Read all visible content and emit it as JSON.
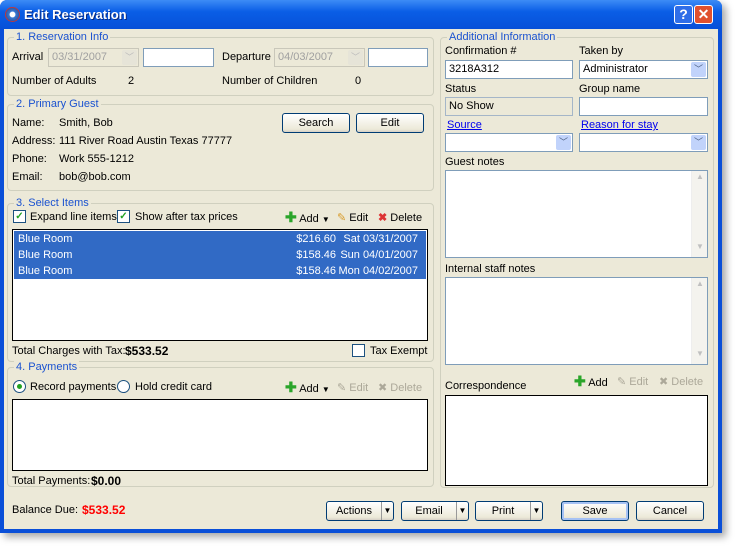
{
  "window": {
    "title": "Edit Reservation",
    "help": "?",
    "close": "✕"
  },
  "reservation": {
    "legend": "1. Reservation Info",
    "arrival_label": "Arrival",
    "arrival_date": "03/31/2007",
    "arrival_time": "",
    "departure_label": "Departure",
    "departure_date": "04/03/2007",
    "departure_time": "",
    "adults_label": "Number of Adults",
    "adults": "2",
    "children_label": "Number of Children",
    "children": "0"
  },
  "guest": {
    "legend": "2. Primary Guest",
    "name_label": "Name:",
    "name": "Smith, Bob",
    "address_label": "Address:",
    "address": "111 River Road Austin Texas 77777",
    "phone_label": "Phone:",
    "phone": "Work 555-1212",
    "email_label": "Email:",
    "email": "bob@bob.com",
    "search": "Search",
    "edit": "Edit"
  },
  "items": {
    "legend": "3. Select Items",
    "expand": "Expand line items",
    "expand_checked": true,
    "after_tax": "Show after tax prices",
    "after_tax_checked": true,
    "add": "Add",
    "edit": "Edit",
    "delete": "Delete",
    "rows": [
      {
        "name": "Blue Room",
        "price": "$216.60",
        "date": "Sat 03/31/2007"
      },
      {
        "name": "Blue Room",
        "price": "$158.46",
        "date": "Sun 04/01/2007"
      },
      {
        "name": "Blue Room",
        "price": "$158.46",
        "date": "Mon 04/02/2007"
      }
    ],
    "total_label": "Total Charges with Tax:",
    "total": "$533.52",
    "tax_exempt": "Tax Exempt"
  },
  "payments": {
    "legend": "4. Payments",
    "record": "Record payments",
    "hold": "Hold credit card",
    "add": "Add",
    "edit": "Edit",
    "delete": "Delete",
    "total_label": "Total Payments:",
    "total": "$0.00"
  },
  "additional": {
    "legend": "Additional Information",
    "confirmation_label": "Confirmation #",
    "confirmation": "3218A312",
    "taken_by_label": "Taken by",
    "taken_by": "Administrator",
    "status_label": "Status",
    "status": "No Show",
    "group_label": "Group name",
    "group": "",
    "source_label": "Source",
    "reason_label": "Reason for stay",
    "guest_notes_label": "Guest notes",
    "staff_notes_label": "Internal staff notes",
    "correspondence_label": "Correspondence",
    "add": "Add",
    "edit": "Edit",
    "delete": "Delete"
  },
  "footer": {
    "balance_label": "Balance Due:",
    "balance": "$533.52",
    "balance_color": "#ff0000",
    "actions": "Actions",
    "email": "Email",
    "print": "Print",
    "save": "Save",
    "cancel": "Cancel"
  }
}
